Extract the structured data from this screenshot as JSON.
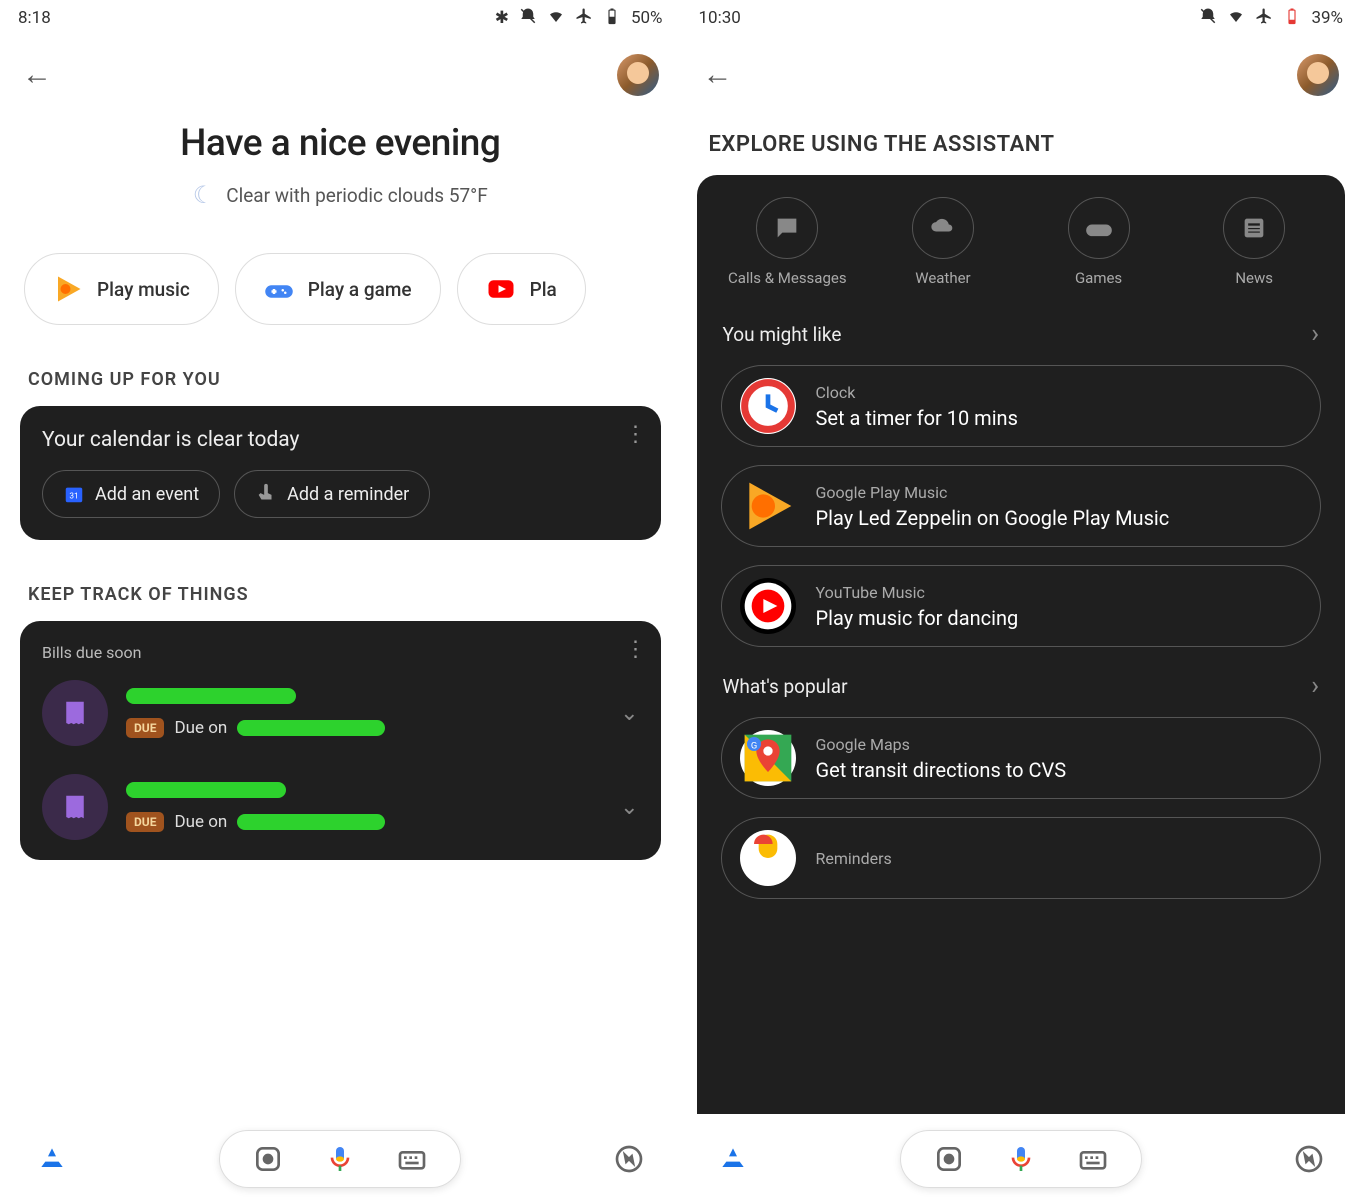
{
  "left": {
    "status": {
      "time": "8:18",
      "battery": "50%"
    },
    "greeting": "Have a nice evening",
    "weather": "Clear with periodic clouds 57°F",
    "chips": [
      {
        "label": "Play music",
        "icon": "play-music"
      },
      {
        "label": "Play a game",
        "icon": "gamepad"
      },
      {
        "label": "Pla",
        "icon": "youtube"
      }
    ],
    "sections": {
      "coming_up": "COMING UP FOR YOU",
      "keep_track": "KEEP TRACK OF THINGS"
    },
    "calendar_card": {
      "title": "Your calendar is clear today",
      "add_event": "Add an event",
      "add_reminder": "Add a reminder"
    },
    "bills_card": {
      "title": "Bills due soon",
      "due_badge": "DUE",
      "due_prefix": "Due on"
    }
  },
  "right": {
    "status": {
      "time": "10:30",
      "battery": "39%"
    },
    "explore_heading": "EXPLORE USING THE ASSISTANT",
    "categories": [
      {
        "label": "Calls & Messages",
        "icon": "chat"
      },
      {
        "label": "Weather",
        "icon": "cloud"
      },
      {
        "label": "Games",
        "icon": "gamepad"
      },
      {
        "label": "News",
        "icon": "news"
      }
    ],
    "you_might_like": "You might like",
    "whats_popular": "What's popular",
    "suggestions_like": [
      {
        "app": "Clock",
        "cmd": "Set a timer for 10 mins",
        "icon": "clock"
      },
      {
        "app": "Google Play Music",
        "cmd": "Play Led Zeppelin on Google Play Music",
        "icon": "play-music"
      },
      {
        "app": "YouTube Music",
        "cmd": "Play music for dancing",
        "icon": "yt-music"
      }
    ],
    "suggestions_popular": [
      {
        "app": "Google Maps",
        "cmd": "Get transit directions to CVS",
        "icon": "maps"
      },
      {
        "app": "Reminders",
        "cmd": "",
        "icon": "reminders"
      }
    ]
  }
}
